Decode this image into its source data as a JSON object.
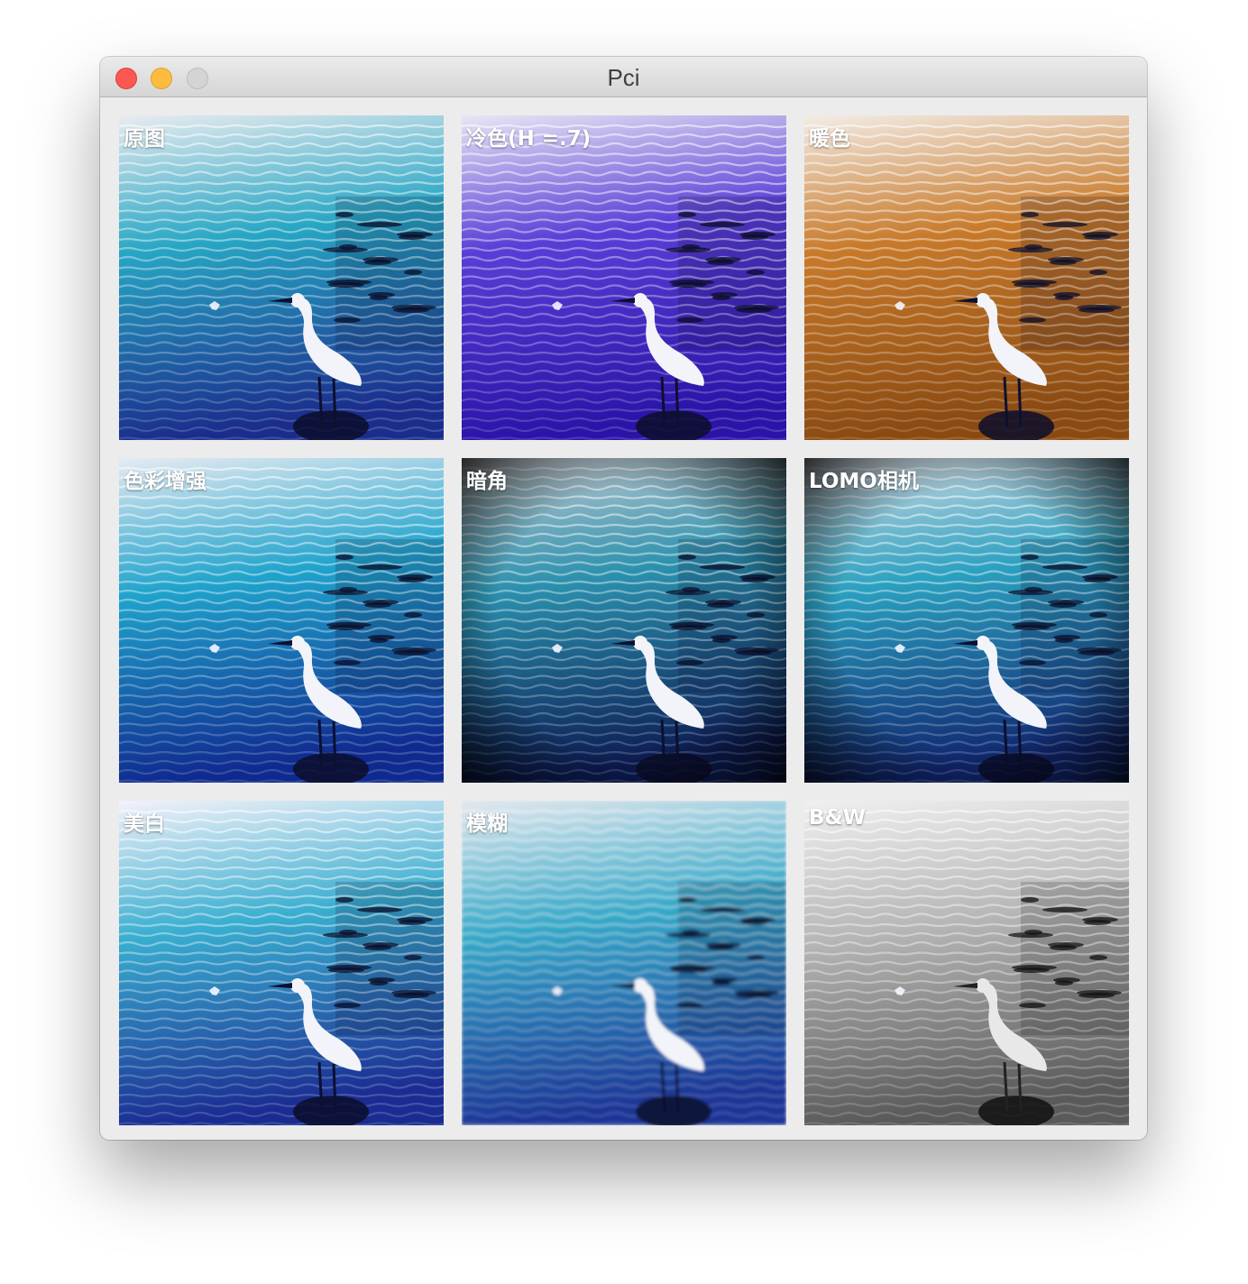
{
  "window": {
    "title": "Pci"
  },
  "filters": [
    {
      "label": "原图",
      "theme": "original"
    },
    {
      "label": "冷色(H =.7)",
      "theme": "cool"
    },
    {
      "label": "暖色",
      "theme": "warm"
    },
    {
      "label": "色彩增强",
      "theme": "enhanced"
    },
    {
      "label": "暗角",
      "theme": "vignette"
    },
    {
      "label": "LOMO相机",
      "theme": "lomo"
    },
    {
      "label": "美白",
      "theme": "whiten"
    },
    {
      "label": "模糊",
      "theme": "blur"
    },
    {
      "label": "B&W",
      "theme": "bw"
    }
  ],
  "themes": {
    "original": {
      "top": "#e9ecf0",
      "mid": "#27a6c4",
      "bottom": "#1a2d8c"
    },
    "cool": {
      "top": "#e8e6f5",
      "mid": "#5a3dd6",
      "bottom": "#2a14a8"
    },
    "warm": {
      "top": "#f3ede6",
      "mid": "#c87a2a",
      "bottom": "#8a4a12"
    },
    "enhanced": {
      "top": "#e6ebf2",
      "mid": "#1fa3cc",
      "bottom": "#0f2a8f"
    },
    "vignette": {
      "top": "#c9ccd2",
      "mid": "#2a90ad",
      "bottom": "#0c1c55"
    },
    "lomo": {
      "top": "#d9dde4",
      "mid": "#2aa0c0",
      "bottom": "#102670"
    },
    "whiten": {
      "top": "#f4f2fa",
      "mid": "#39aed0",
      "bottom": "#1a2c92"
    },
    "blur": {
      "top": "#e4e8ee",
      "mid": "#33a8c8",
      "bottom": "#1b3596"
    },
    "bw": {
      "top": "#f0f0f0",
      "mid": "#b8b8b8",
      "bottom": "#5a5a5a"
    }
  }
}
